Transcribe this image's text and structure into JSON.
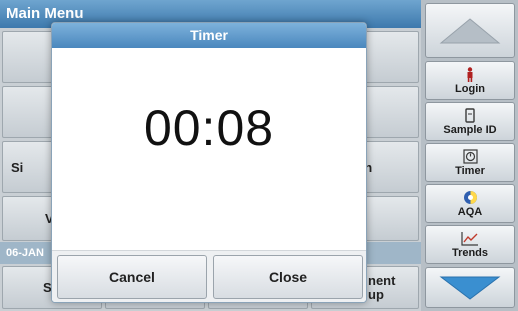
{
  "main": {
    "title": "Main Menu",
    "date": "06-JAN",
    "partial_labels": {
      "left_row3": "Si",
      "left_row4": "V",
      "right_row3": "gth",
      "left_row6": "S",
      "right_row6_a": "nent",
      "right_row6_b": "up"
    }
  },
  "sidebar": {
    "items": [
      {
        "label": "Login",
        "icon": "person-icon"
      },
      {
        "label": "Sample ID",
        "icon": "sample-icon"
      },
      {
        "label": "Timer",
        "icon": "timer-icon"
      },
      {
        "label": "AQA",
        "icon": "aqa-icon"
      },
      {
        "label": "Trends",
        "icon": "trends-icon"
      }
    ]
  },
  "dialog": {
    "title": "Timer",
    "time": "00:08",
    "cancel_label": "Cancel",
    "close_label": "Close"
  },
  "colors": {
    "title_bar": "#4a87bd",
    "scroll_arrow_down": "#3a8fd0",
    "scroll_arrow_up": "#b5bec6"
  }
}
